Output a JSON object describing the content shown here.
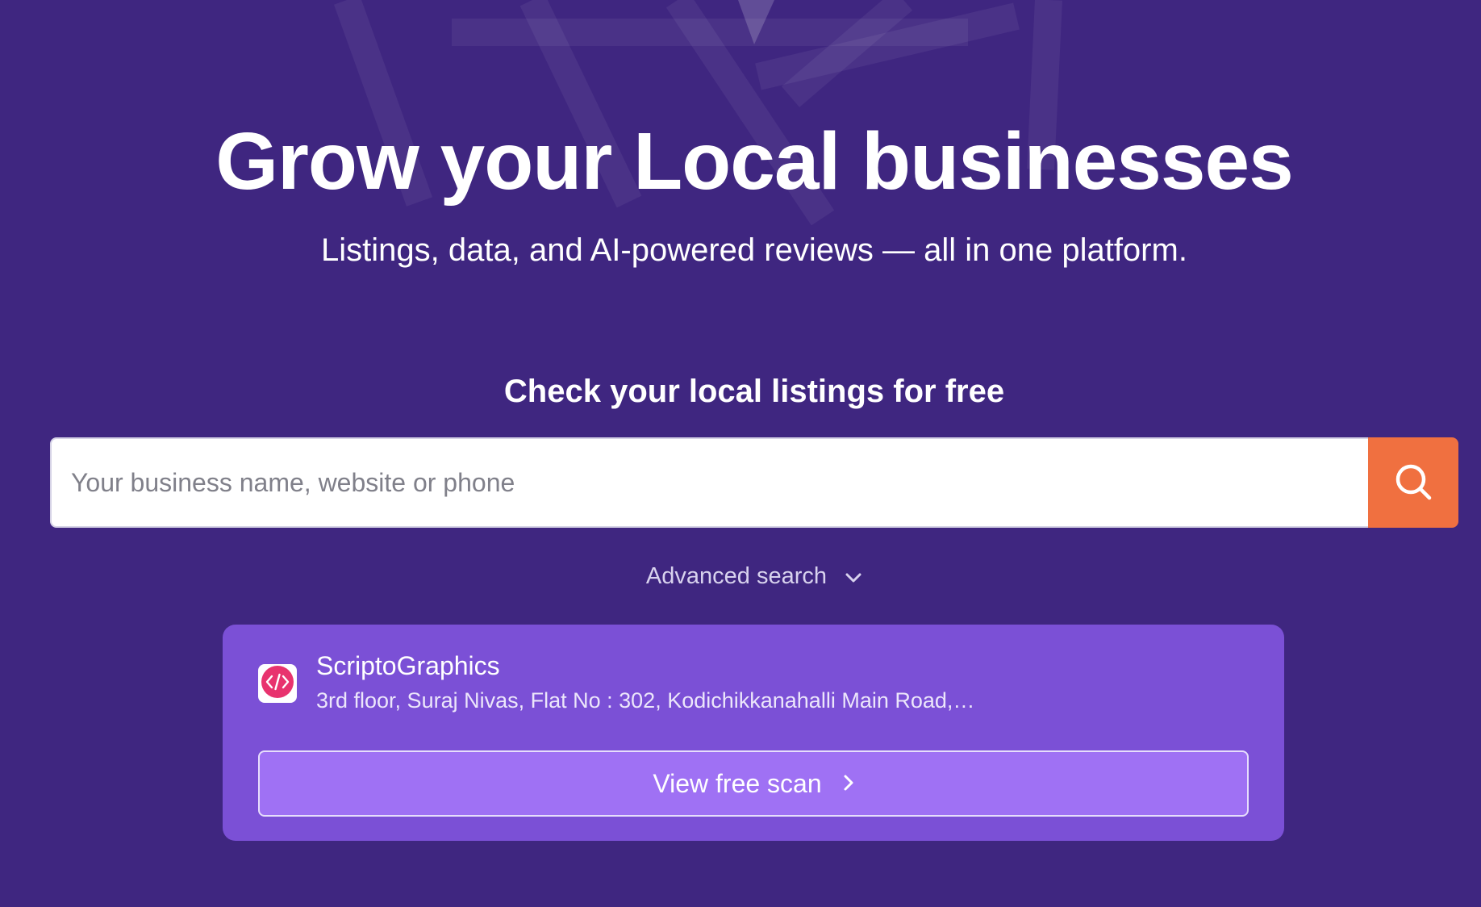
{
  "hero": {
    "title": "Grow your Local businesses",
    "subtitle": "Listings, data, and AI-powered reviews — all in one platform."
  },
  "search": {
    "heading": "Check your local listings for free",
    "placeholder": "Your business name, website or phone",
    "value": "",
    "button_icon": "search-icon",
    "advanced_label": "Advanced search",
    "advanced_icon": "chevron-down-icon"
  },
  "result": {
    "business_name": "ScriptoGraphics",
    "address": "3rd floor, Suraj Nivas, Flat No : 302, Kodichikkanahalli Main Road,…",
    "logo_icon": "code-icon",
    "scan_label": "View free scan",
    "scan_icon": "chevron-right-icon"
  },
  "colors": {
    "background": "#3f2680",
    "accent_orange": "#f07040",
    "card": "#7b50d6",
    "card_button": "#9f71f4",
    "logo_pink": "#e8336e"
  }
}
